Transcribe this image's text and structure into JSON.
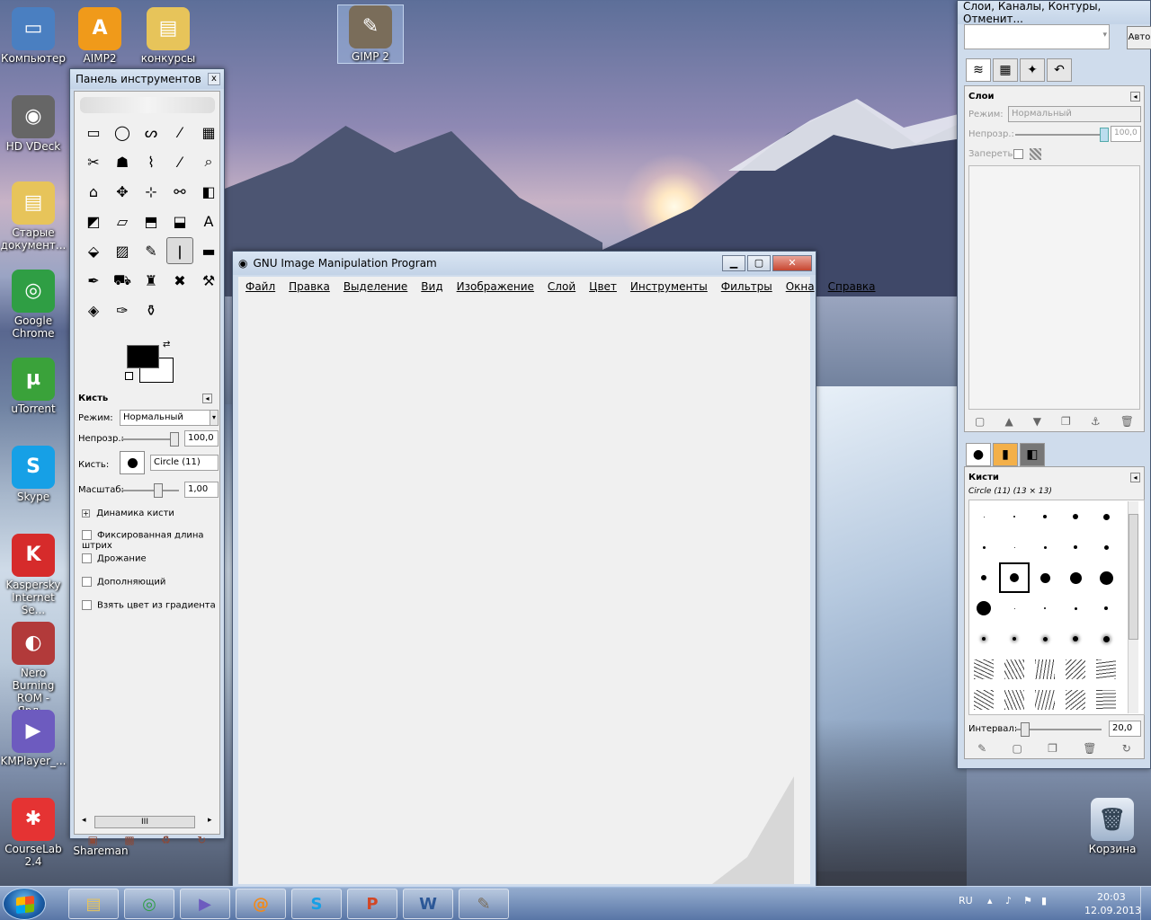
{
  "desktop": {
    "icons_left": [
      {
        "label": "Компьютер",
        "icon": "computer-icon",
        "glyph": "▭",
        "color": "#4a7fc1"
      },
      {
        "label": "HD VDeck",
        "icon": "hdvdeck-icon",
        "glyph": "◉",
        "color": "#666666"
      },
      {
        "label": "Старые документ...",
        "icon": "folder-icon",
        "glyph": "▤",
        "color": "#e7c45a"
      },
      {
        "label": "Google Chrome",
        "icon": "chrome-icon",
        "glyph": "◎",
        "color": "#2f9e44"
      },
      {
        "label": "uTorrent",
        "icon": "utorrent-icon",
        "glyph": "µ",
        "color": "#3aa23a"
      },
      {
        "label": "Skype",
        "icon": "skype-icon",
        "glyph": "S",
        "color": "#16a0e6"
      },
      {
        "label": "Kaspersky Internet Se...",
        "icon": "kaspersky-icon",
        "glyph": "K",
        "color": "#d62b2b"
      },
      {
        "label": "Nero Burning ROM - Ярл...",
        "icon": "nero-icon",
        "glyph": "◐",
        "color": "#b23a3a"
      },
      {
        "label": "KMPlayer_...",
        "icon": "kmplayer-icon",
        "glyph": "▶",
        "color": "#6d5bbf"
      },
      {
        "label": "CourseLab 2.4",
        "icon": "courselab-icon",
        "glyph": "✱",
        "color": "#e53333"
      }
    ],
    "icons_top": [
      {
        "label": "AIMP2",
        "icon": "aimp-icon",
        "glyph": "A",
        "color": "#f09a1a"
      },
      {
        "label": "конкурсы",
        "icon": "folder-icon",
        "glyph": "▤",
        "color": "#e7c45a"
      },
      {
        "label": "GIMP 2",
        "icon": "gimp-icon",
        "glyph": "✎",
        "color": "#7a6d5a"
      }
    ],
    "shareman_label": "Shareman",
    "recycle_label": "Корзина"
  },
  "toolbox": {
    "title": "Панель инструментов",
    "close": "x",
    "tools": [
      "▭",
      "◯",
      "ᔕ",
      "⁄",
      "▦",
      "✂",
      "☗",
      "⌇",
      "⁄",
      "⌕",
      "⌂",
      "✥",
      "⊹",
      "⚯",
      "◧",
      "◩",
      "▱",
      "⬒",
      "⬓",
      "A",
      "⬙",
      "▨",
      "✎",
      "ǀ",
      "▬",
      "✒",
      "⛟",
      "♜",
      "✖",
      "⚒",
      "◈",
      "✑",
      "⚱"
    ],
    "active_tool_index": 23,
    "options_title": "Кисть",
    "mode_label": "Режим:",
    "mode_value": "Нормальный",
    "opacity_label": "Непрозр.:",
    "opacity_value": "100,0",
    "brush_label": "Кисть:",
    "brush_value": "Circle (11)",
    "scale_label": "Масштаб:",
    "scale_value": "1,00",
    "dynamics_label": "Динамика кисти",
    "checkboxes": [
      "Фиксированная длина штрих",
      "Дрожание",
      "Дополняющий",
      "Взять цвет из градиента"
    ],
    "scroll_grip": "III",
    "bottom_icons": [
      "▣",
      "▩",
      "♻",
      "↻"
    ]
  },
  "main_window": {
    "title": "GNU Image Manipulation Program",
    "controls": [
      "▁",
      "▢",
      "✕"
    ],
    "menu": [
      "Файл",
      "Правка",
      "Выделение",
      "Вид",
      "Изображение",
      "Слой",
      "Цвет",
      "Инструменты",
      "Фильтры",
      "Окна",
      "Справка"
    ]
  },
  "dock": {
    "title": "Слои, Каналы, Контуры, Отменит...",
    "auto_button": "Авто",
    "tabs": [
      "≋",
      "▦",
      "✦",
      "↶"
    ],
    "layers_title": "Слои",
    "mode_label": "Режим:",
    "mode_value": "Нормальный",
    "opacity_label": "Непрозр.:",
    "opacity_value": "100,0",
    "lock_label": "Запереть:",
    "layer_buttons": [
      "▢",
      "▲",
      "▼",
      "❐",
      "⚓",
      "🗑"
    ],
    "brush_tabs": [
      "●",
      "▮",
      "◧"
    ],
    "brushes_title": "Кисти",
    "brush_current": "Circle (11) (13 × 13)",
    "interval_label": "Интервал:",
    "interval_value": "20,0",
    "brush_buttons": [
      "✎",
      "▢",
      "❐",
      "🗑",
      "↻"
    ]
  },
  "taskbar": {
    "apps": [
      {
        "icon": "explorer-icon",
        "glyph": "▤",
        "color": "#e7c45a"
      },
      {
        "icon": "chrome-icon",
        "glyph": "◎",
        "color": "#2f9e44"
      },
      {
        "icon": "kmplayer-icon",
        "glyph": "▶",
        "color": "#6d5bbf"
      },
      {
        "icon": "mail-agent-icon",
        "glyph": "@",
        "color": "#f08a1c"
      },
      {
        "icon": "skype-icon",
        "glyph": "S",
        "color": "#16a0e6"
      },
      {
        "icon": "powerpoint-icon",
        "glyph": "P",
        "color": "#d24726"
      },
      {
        "icon": "word-icon",
        "glyph": "W",
        "color": "#2b5797"
      },
      {
        "icon": "gimp-icon",
        "glyph": "✎",
        "color": "#7a6d5a"
      }
    ],
    "lang": "RU",
    "time": "20:03",
    "date": "12.09.2013"
  }
}
